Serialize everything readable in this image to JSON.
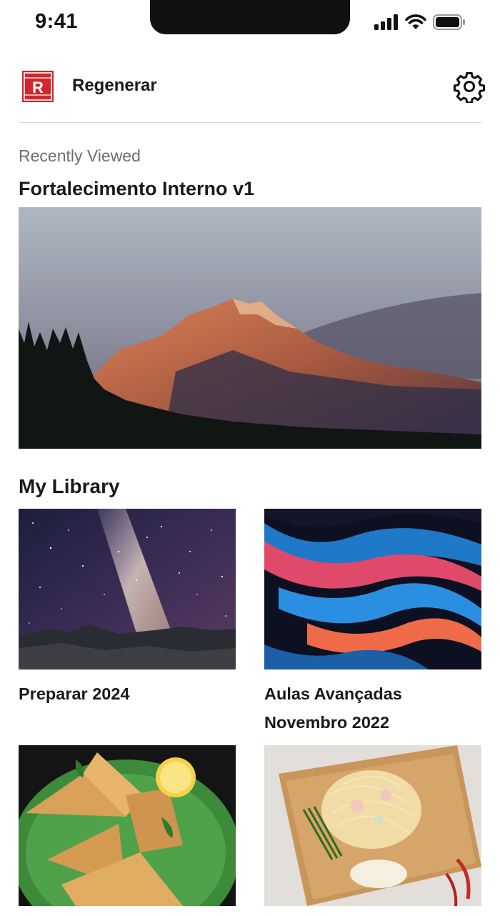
{
  "status_bar": {
    "time": "9:41"
  },
  "header": {
    "app_name": "Regenerar",
    "logo_letter": "R",
    "brand_color": "#d0262d"
  },
  "recent": {
    "caption": "Recently Viewed",
    "title": "Fortalecimento Interno v1",
    "image": "mountain-sunset-photo"
  },
  "library": {
    "heading": "My Library",
    "items": [
      {
        "title": "Preparar 2024",
        "image": "milky-way-night-sky-photo"
      },
      {
        "title": "Aulas Avançadas Novembro 2022",
        "image": "fluid-abstract-art"
      },
      {
        "title": "",
        "image": "samosa-plate-photo"
      },
      {
        "title": "",
        "image": "noodle-salad-cutting-board-photo"
      }
    ]
  }
}
